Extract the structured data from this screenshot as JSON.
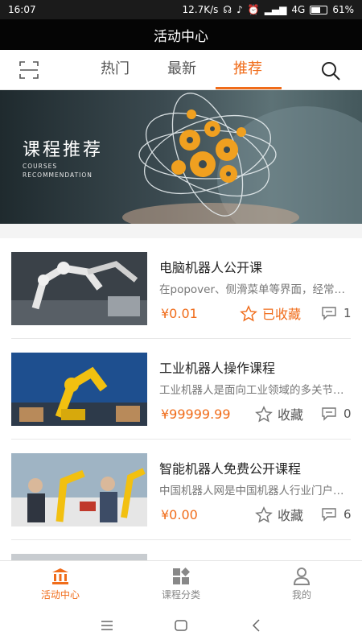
{
  "status_bar": {
    "time": "16:07",
    "speed": "12.7K/s",
    "network": "4G",
    "battery": "61%",
    "battery_level": 0.61
  },
  "header": {
    "title": "活动中心"
  },
  "tabs": [
    {
      "label": "热门",
      "active": false
    },
    {
      "label": "最新",
      "active": false
    },
    {
      "label": "推荐",
      "active": true
    }
  ],
  "icons": {
    "scan": "scan-icon",
    "search": "search-icon"
  },
  "banner": {
    "title": "课程推荐",
    "subtitle_line1": "COURSES",
    "subtitle_line2": "RECOMMENDATION"
  },
  "courses": [
    {
      "title": "电脑机器人公开课",
      "description": "在popover、侧滑菜单等界面，经常使用",
      "price": "¥0.01",
      "favorite_label": "已收藏",
      "favorited": true,
      "comments": "1"
    },
    {
      "title": "工业机器人操作课程",
      "description": "工业机器人是面向工业领域的多关节机械手",
      "price": "¥99999.99",
      "favorite_label": "收藏",
      "favorited": false,
      "comments": "0"
    },
    {
      "title": "智能机器人免费公开课程",
      "description": "中国机器人网是中国机器人行业门户网站",
      "price": "¥0.00",
      "favorite_label": "收藏",
      "favorited": false,
      "comments": "6"
    }
  ],
  "bottom_nav": [
    {
      "label": "活动中心",
      "icon": "bank-icon",
      "active": true
    },
    {
      "label": "课程分类",
      "icon": "category-icon",
      "active": false
    },
    {
      "label": "我的",
      "icon": "user-icon",
      "active": false
    }
  ],
  "colors": {
    "accent": "#f06c1a",
    "title_bar": "#050505"
  }
}
